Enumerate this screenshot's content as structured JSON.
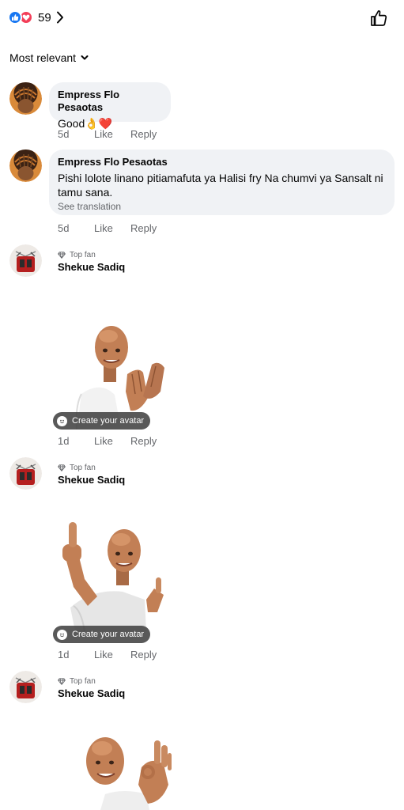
{
  "header": {
    "reaction_count": "59",
    "icons": [
      "like-reaction-icon",
      "love-reaction-icon",
      "chevron-right-icon",
      "thumbs-up-icon"
    ]
  },
  "sort": {
    "label": "Most relevant"
  },
  "comments": [
    {
      "author": "Empress Flo Pesaotas",
      "text": "Good👌❤️",
      "time": "5d",
      "like": "Like",
      "reply": "Reply"
    },
    {
      "author": "Empress Flo Pesaotas",
      "text": "Pishi lolote  linano pitiamafuta ya Halisi fry Na chumvi ya Sansalt ni tamu sana.",
      "see_translation": "See translation",
      "time": "5d",
      "like": "Like",
      "reply": "Reply"
    },
    {
      "badge": "Top fan",
      "author": "Shekue Sadiq",
      "sticker": "avatar-clapping",
      "create_avatar": "Create your avatar",
      "time": "1d",
      "like": "Like",
      "reply": "Reply"
    },
    {
      "badge": "Top fan",
      "author": "Shekue Sadiq",
      "sticker": "avatar-thumbs-up",
      "create_avatar": "Create your avatar",
      "time": "1d",
      "like": "Like",
      "reply": "Reply"
    },
    {
      "badge": "Top fan",
      "author": "Shekue Sadiq",
      "sticker": "avatar-ok-sign"
    }
  ],
  "colors": {
    "like_blue": "#1877f2",
    "love_red": "#f33e58",
    "bubble_bg": "#f0f2f5",
    "muted": "#65676b"
  }
}
